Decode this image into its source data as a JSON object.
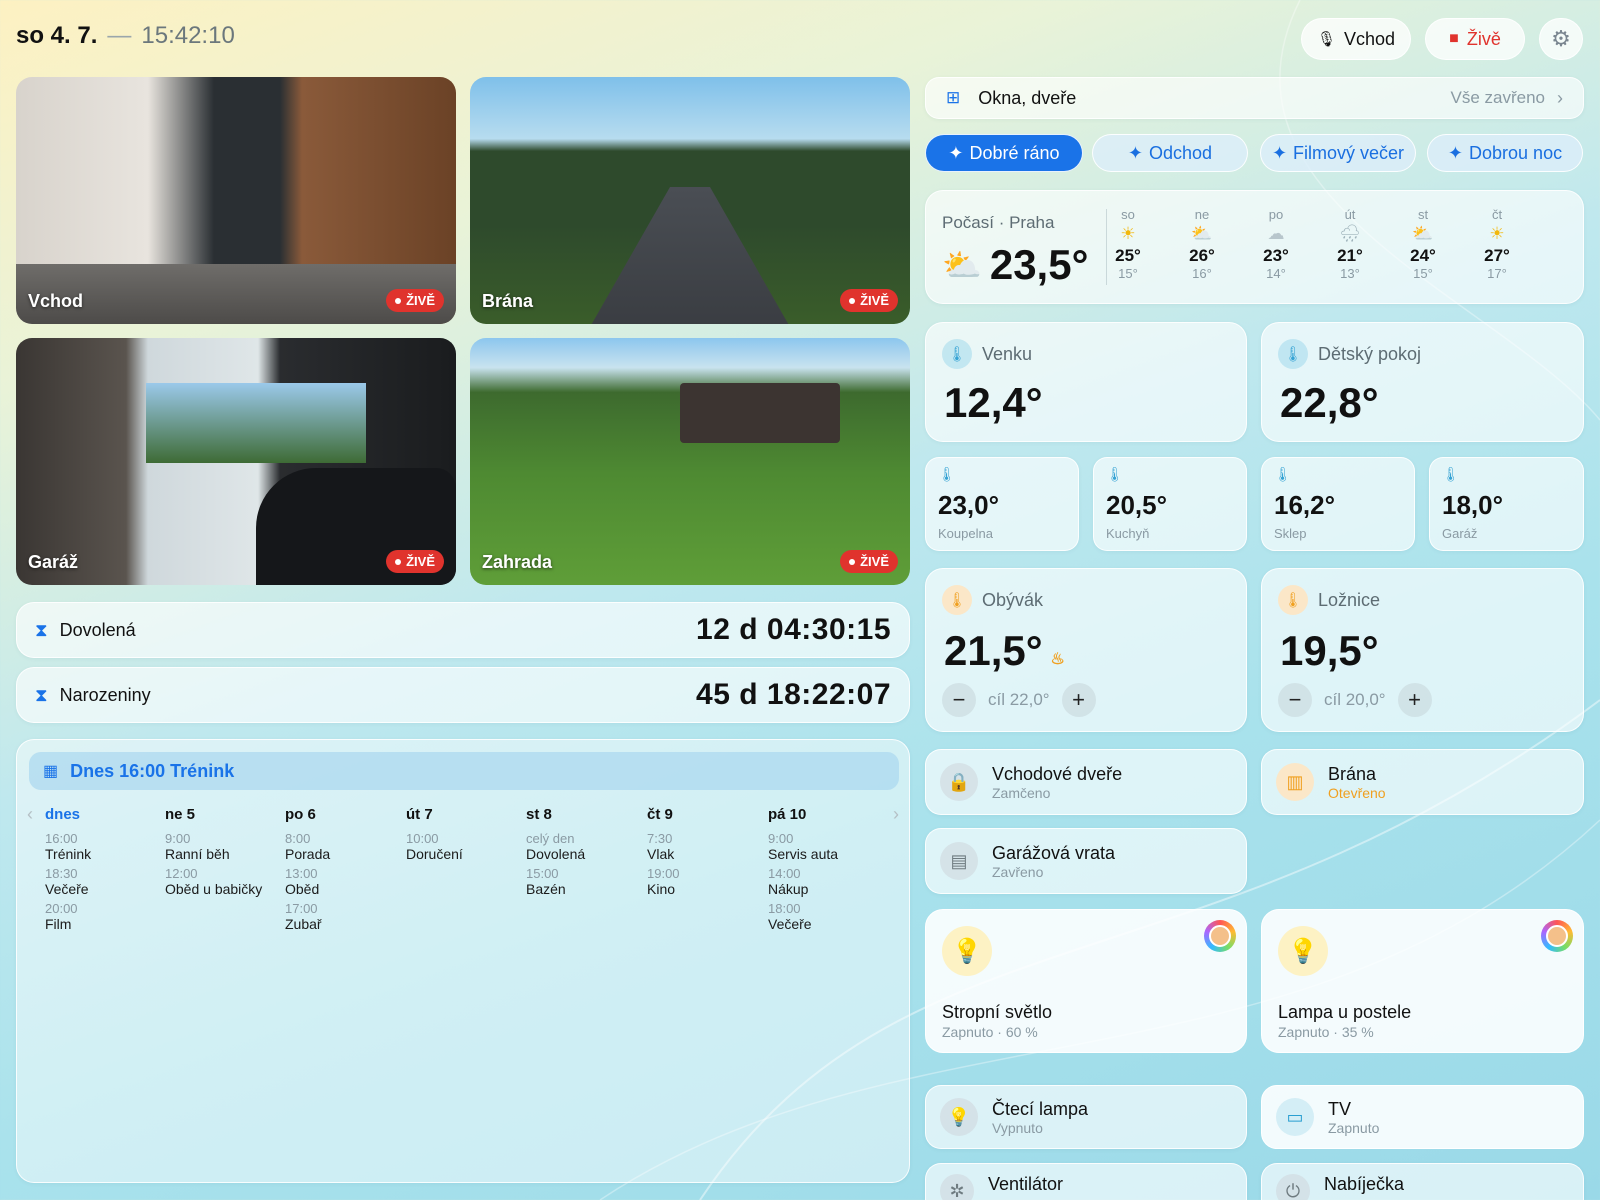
{
  "header": {
    "date": "so 4. 7.",
    "sep": "—",
    "time": "15:42:10",
    "mic_label": "Vchod",
    "live_label": "Živě"
  },
  "cameras": [
    {
      "name": "Vchod",
      "live": "ŽIVĚ"
    },
    {
      "name": "Brána",
      "live": "ŽIVĚ"
    },
    {
      "name": "Garáž",
      "live": "ŽIVĚ"
    },
    {
      "name": "Zahrada",
      "live": "ŽIVĚ"
    }
  ],
  "countdowns": [
    {
      "label": "Dovolená",
      "value": "12 d 04:30:15"
    },
    {
      "label": "Narozeniny",
      "value": "45 d 18:22:07"
    }
  ],
  "calendar": {
    "banner": "Dnes 16:00 Trénink",
    "days": [
      {
        "label": "dnes",
        "events": [
          {
            "t": "16:00",
            "n": "Trénink"
          },
          {
            "t": "18:30",
            "n": "Večeře"
          },
          {
            "t": "20:00",
            "n": "Film"
          }
        ]
      },
      {
        "label": "ne 5",
        "events": [
          {
            "t": "9:00",
            "n": "Ranní běh"
          },
          {
            "t": "12:00",
            "n": "Oběd u babičky"
          }
        ]
      },
      {
        "label": "po 6",
        "events": [
          {
            "t": "8:00",
            "n": "Porada"
          },
          {
            "t": "13:00",
            "n": "Oběd"
          },
          {
            "t": "17:00",
            "n": "Zubař"
          }
        ]
      },
      {
        "label": "út 7",
        "events": [
          {
            "t": "10:00",
            "n": "Doručení"
          }
        ]
      },
      {
        "label": "st 8",
        "events": [
          {
            "t": "celý den",
            "n": "Dovolená"
          },
          {
            "t": "15:00",
            "n": "Bazén"
          }
        ]
      },
      {
        "label": "čt 9",
        "events": [
          {
            "t": "7:30",
            "n": "Vlak"
          },
          {
            "t": "19:00",
            "n": "Kino"
          }
        ]
      },
      {
        "label": "pá 10",
        "events": [
          {
            "t": "9:00",
            "n": "Servis auta"
          },
          {
            "t": "14:00",
            "n": "Nákup"
          },
          {
            "t": "18:00",
            "n": "Večeře"
          }
        ]
      }
    ]
  },
  "windows": {
    "label": "Okna, dveře",
    "status": "Vše zavřeno"
  },
  "scenes": [
    "Dobré ráno",
    "Odchod",
    "Filmový večer",
    "Dobrou noc"
  ],
  "weather": {
    "title": "Počasí · Praha",
    "current": "23,5°",
    "forecast": [
      {
        "d": "so",
        "icon": "sun-icon",
        "h": "25°",
        "l": "15°"
      },
      {
        "d": "ne",
        "icon": "partly-cloudy-icon",
        "h": "26°",
        "l": "16°"
      },
      {
        "d": "po",
        "icon": "cloud-icon",
        "h": "23°",
        "l": "14°"
      },
      {
        "d": "út",
        "icon": "rain-icon",
        "h": "21°",
        "l": "13°"
      },
      {
        "d": "st",
        "icon": "partly-cloudy-icon",
        "h": "24°",
        "l": "15°"
      },
      {
        "d": "čt",
        "icon": "sun-icon",
        "h": "27°",
        "l": "17°"
      }
    ]
  },
  "temps": {
    "venku": {
      "label": "Venku",
      "value": "12,4°"
    },
    "detsky": {
      "label": "Dětský pokoj",
      "value": "22,8°"
    },
    "small": [
      {
        "value": "23,0°",
        "label": "Koupelna"
      },
      {
        "value": "20,5°",
        "label": "Kuchyň"
      },
      {
        "value": "16,2°",
        "label": "Sklep"
      },
      {
        "value": "18,0°",
        "label": "Garáž"
      }
    ]
  },
  "thermostats": [
    {
      "label": "Obývák",
      "value": "21,5°",
      "target": "cíl 22,0°",
      "heating": true
    },
    {
      "label": "Ložnice",
      "value": "19,5°",
      "target": "cíl 20,0°"
    }
  ],
  "devices": {
    "door": {
      "name": "Vchodové dveře",
      "status": "Zamčeno"
    },
    "gate": {
      "name": "Brána",
      "status": "Otevřeno"
    },
    "garage": {
      "name": "Garážová vrata",
      "status": "Zavřeno"
    },
    "light1": {
      "name": "Stropní světlo",
      "status": "Zapnuto · 60 %"
    },
    "light2": {
      "name": "Lampa u postele",
      "status": "Zapnuto · 35 %"
    },
    "reading": {
      "name": "Čtecí lampa",
      "status": "Vypnuto"
    },
    "tv": {
      "name": "TV",
      "status": "Zapnuto"
    },
    "fan": {
      "name": "Ventilátor"
    },
    "charger": {
      "name": "Nabíječka"
    }
  },
  "colors": {
    "accent": "#1a73e8",
    "live": "#e0332d",
    "open": "#f0a020"
  }
}
